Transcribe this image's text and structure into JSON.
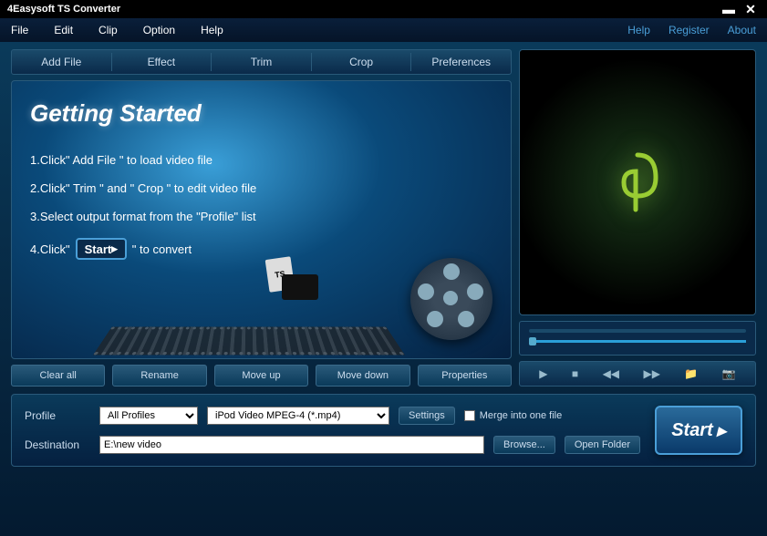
{
  "title": "4Easysoft TS Converter",
  "menu": {
    "left": [
      "File",
      "Edit",
      "Clip",
      "Option",
      "Help"
    ],
    "right": [
      "Help",
      "Register",
      "About"
    ]
  },
  "toolbar": [
    "Add File",
    "Effect",
    "Trim",
    "Crop",
    "Preferences"
  ],
  "getting_started": {
    "heading": "Getting Started",
    "step1": "1.Click\" Add File \" to load video file",
    "step2": "2.Click\" Trim \" and \" Crop \" to edit video file",
    "step3": "3.Select output format from the \"Profile\" list",
    "step4_pre": "4.Click\"",
    "step4_btn": "Start",
    "step4_post": "\" to convert",
    "ts_label": "TS"
  },
  "actions": [
    "Clear all",
    "Rename",
    "Move up",
    "Move down",
    "Properties"
  ],
  "profile": {
    "label": "Profile",
    "filter": "All Profiles",
    "format": "iPod Video MPEG-4 (*.mp4)",
    "settings": "Settings",
    "merge": "Merge into one file"
  },
  "destination": {
    "label": "Destination",
    "path": "E:\\new video",
    "browse": "Browse...",
    "open": "Open Folder"
  },
  "start": "Start"
}
